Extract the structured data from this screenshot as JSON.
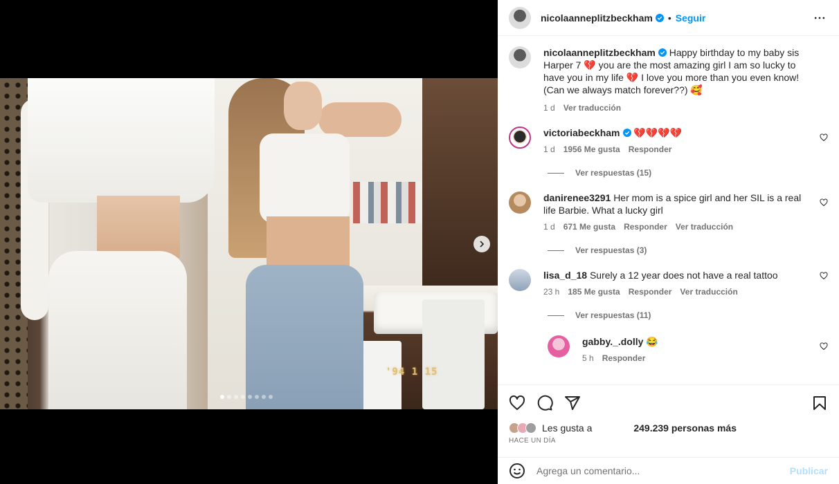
{
  "post": {
    "author": "nicolaanneplitzbeckham",
    "follow_label": "Seguir",
    "separator": "•",
    "caption": "Happy birthday to my baby sis Harper 7 💔 you are the most amazing girl I am so lucky to have you in my life 💔 I love you more than you even know! (Can we always match forever??) 🥰",
    "caption_time": "1 d",
    "caption_translate": "Ver traducción",
    "photo_stamp": "'94  1 15"
  },
  "comments": [
    {
      "user": "victoriabeckham",
      "verified": true,
      "text": "💔💔💔💔",
      "time": "1 d",
      "likes": "1956 Me gusta",
      "reply": "Responder",
      "translate": "",
      "replies": "Ver respuestas (15)"
    },
    {
      "user": "danirenee3291",
      "verified": false,
      "text": "Her mom is a spice girl and her SIL is a real life Barbie. What a lucky girl",
      "time": "1 d",
      "likes": "671 Me gusta",
      "reply": "Responder",
      "translate": "Ver traducción",
      "replies": "Ver respuestas (3)"
    },
    {
      "user": "lisa_d_18",
      "verified": false,
      "text": "Surely a 12 year does not have a real tattoo",
      "time": "23 h",
      "likes": "185 Me gusta",
      "reply": "Responder",
      "translate": "Ver traducción",
      "replies": "Ver respuestas (11)"
    }
  ],
  "nested_reply": {
    "user": "gabby._.dolly",
    "text": "😂",
    "time": "5 h",
    "reply": "Responder"
  },
  "likes_bar": {
    "label": "Les gusta a",
    "count": "249.239 personas más",
    "ago": "HACE UN DÍA"
  },
  "add_comment": {
    "placeholder": "Agrega un comentario...",
    "post_label": "Publicar"
  },
  "colors": {
    "accent": "#0095f6",
    "like_red": "#ed4956",
    "muted": "#737373"
  }
}
